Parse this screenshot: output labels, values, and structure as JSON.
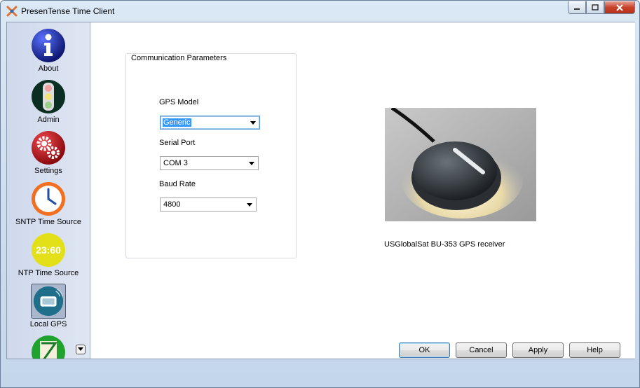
{
  "window": {
    "title": "PresenTense Time Client"
  },
  "sidebar": {
    "items": [
      {
        "label": "About",
        "icon": "info-icon",
        "color": "#1d2ea0"
      },
      {
        "label": "Admin",
        "icon": "traffic-light-icon",
        "color": "#0c3a2a"
      },
      {
        "label": "Settings",
        "icon": "gears-icon",
        "color": "#c4161c"
      },
      {
        "label": "SNTP Time Source",
        "icon": "clock-icon",
        "color": "#f26f21"
      },
      {
        "label": "NTP Time Source",
        "icon": "ntp-clock-icon",
        "color": "#e8e41c",
        "badge": "23:60"
      },
      {
        "label": "Local GPS",
        "icon": "gps-receiver-icon",
        "color": "#1f6f8b"
      },
      {
        "label": "",
        "icon": "timezone-icon",
        "color": "#1fa32e"
      }
    ]
  },
  "group": {
    "legend": "Communication Parameters",
    "gps_model_label": "GPS Model",
    "gps_model_value": "Generic",
    "serial_port_label": "Serial Port",
    "serial_port_value": "COM 3",
    "baud_rate_label": "Baud Rate",
    "baud_rate_value": "4800"
  },
  "photo": {
    "caption": "USGlobalSat BU-353 GPS receiver"
  },
  "buttons": {
    "ok": "OK",
    "cancel": "Cancel",
    "apply": "Apply",
    "help": "Help"
  }
}
